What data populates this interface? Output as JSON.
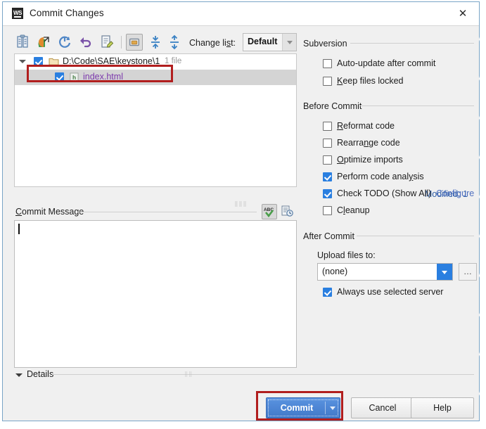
{
  "window": {
    "title": "Commit Changes",
    "app_icon": "webstorm-icon",
    "close_icon": "✕"
  },
  "toolbar": {
    "icons": [
      {
        "name": "show-diff-icon",
        "label": "Show Diff"
      },
      {
        "name": "show-diff-external-icon",
        "label": "Show Diff in External Tool"
      },
      {
        "name": "refresh-icon",
        "label": "Refresh"
      },
      {
        "name": "revert-icon",
        "label": "Revert"
      },
      {
        "name": "edit-source-icon",
        "label": "Edit Source"
      },
      {
        "name": "group-by-directory-icon",
        "label": "Group by Directory"
      },
      {
        "name": "expand-all-icon",
        "label": "Expand All"
      },
      {
        "name": "collapse-all-icon",
        "label": "Collapse All"
      }
    ],
    "changelist_label": "Change list:",
    "changelist_label_pre": "Change li",
    "changelist_label_mnemonic": "s",
    "changelist_label_post": "t:",
    "changelist_value": "Default"
  },
  "filelist": {
    "directory": "D:\\Code\\SAE\\keystone\\1",
    "file_count": "1 file",
    "file_name": "index.html",
    "dir_checked": true,
    "file_checked": true
  },
  "status": {
    "modified": "Modified: 1"
  },
  "commit_message": {
    "label": "Commit Message",
    "label_mnemonic": "C",
    "label_rest": "ommit Message",
    "value": "",
    "placeholder": "",
    "spellcheck_icon": "spellcheck-icon",
    "history_icon": "commit-message-history-icon"
  },
  "details": {
    "label": "Details"
  },
  "right_panel": {
    "subversion": {
      "title": "Subversion",
      "options": [
        {
          "label": "Auto-update after commit",
          "checked": false,
          "mnemonic": "",
          "pre": "Auto-update after commit",
          "post": ""
        },
        {
          "label": "Keep files locked",
          "checked": false,
          "mnemonic": "K",
          "pre": "",
          "post": "eep files locked"
        }
      ]
    },
    "before_commit": {
      "title": "Before Commit",
      "options": [
        {
          "label": "Reformat code",
          "checked": false,
          "mnemonic": "R",
          "pre": "",
          "post": "eformat code"
        },
        {
          "label": "Rearrange code",
          "checked": false,
          "mnemonic": "n",
          "pre": "Rearra",
          "post": "ge code"
        },
        {
          "label": "Optimize imports",
          "checked": false,
          "mnemonic": "O",
          "pre": "",
          "post": "ptimize imports"
        },
        {
          "label": "Perform code analysis",
          "checked": true,
          "mnemonic": "y",
          "pre": "Perform code anal",
          "post": "sis"
        },
        {
          "label": "Check TODO (Show All)",
          "checked": true,
          "mnemonic": "",
          "pre": "Check TODO (Show All)",
          "post": ""
        },
        {
          "label": "Cleanup",
          "checked": false,
          "mnemonic": "l",
          "pre": "C",
          "post": "eanup"
        }
      ],
      "configure_link": "Configure"
    },
    "after_commit": {
      "title": "After Commit",
      "upload_label": "Upload files to:",
      "upload_value": "(none)",
      "browse_label": "…",
      "always_use_label": "Always use selected server",
      "always_use_checked": true
    }
  },
  "buttons": {
    "commit": "Commit",
    "cancel": "Cancel",
    "help": "Help"
  },
  "colors": {
    "accent_blue": "#2a7fe0",
    "commit_button": "#4179c9",
    "link": "#4f6fbf",
    "status_text": "#2f5fa8",
    "file_name": "#7c3aad",
    "annotation_red": "#b11e1e"
  }
}
